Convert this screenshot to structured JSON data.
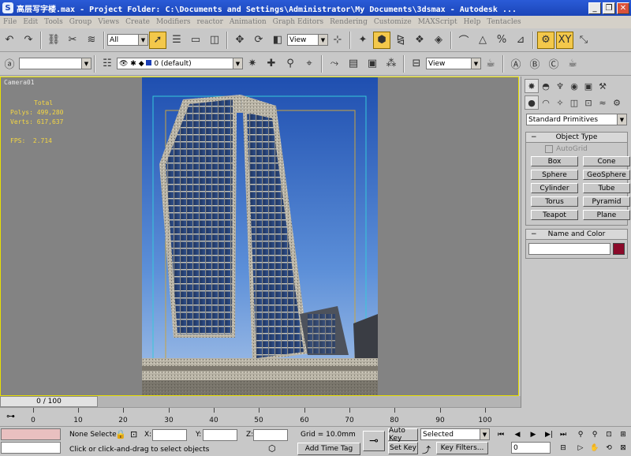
{
  "window": {
    "title": "高层写字楼.max    - Project Folder: C:\\Documents and Settings\\Administrator\\My Documents\\3dsmax    - Autodesk ...",
    "minimize": "_",
    "maximize": "❐",
    "close": "✕"
  },
  "menu": [
    "File",
    "Edit",
    "Tools",
    "Group",
    "Views",
    "Create",
    "Modifiers",
    "reactor",
    "Animation",
    "Graph Editors",
    "Rendering",
    "Customize",
    "MAXScript",
    "Help",
    "Tentacles"
  ],
  "toolbar": {
    "selection_filter": "All",
    "reference_coord": "View",
    "layer": "0 (default)",
    "render_view": "View",
    "named_selection": ""
  },
  "viewport": {
    "label": "Camera01",
    "stats_header": "Total",
    "polys_label": "Polys:",
    "polys": "499,280",
    "verts_label": "Verts:",
    "verts": "617,637",
    "fps_label": "FPS:",
    "fps": "2.714"
  },
  "command_panel": {
    "category": "Standard Primitives",
    "object_type_title": "Object Type",
    "autogrid": "AutoGrid",
    "objects": [
      "Box",
      "Cone",
      "Sphere",
      "GeoSphere",
      "Cylinder",
      "Tube",
      "Torus",
      "Pyramid",
      "Teapot",
      "Plane"
    ],
    "name_color_title": "Name and Color",
    "name_value": "",
    "color": "#8b0a2a"
  },
  "timeline": {
    "slider": "0 / 100",
    "ticks": [
      "0",
      "10",
      "20",
      "30",
      "40",
      "50",
      "60",
      "70",
      "80",
      "90",
      "100"
    ]
  },
  "status": {
    "selection": "None Selecte",
    "x_label": "X:",
    "y_label": "Y:",
    "z_label": "Z:",
    "grid": "Grid = 10.0mm",
    "auto_key": "Auto Key",
    "set_key": "Set Key",
    "key_mode": "Selected",
    "key_filters": "Key Filters...",
    "prompt": "Click or click-and-drag to select objects",
    "add_time_tag": "Add Time Tag",
    "frame": "0"
  },
  "colors": {
    "viewport_border": "#e8e000",
    "active_tool": "#f3c84b",
    "stats_text": "#f5d742",
    "sky": "#4a7fd0"
  }
}
